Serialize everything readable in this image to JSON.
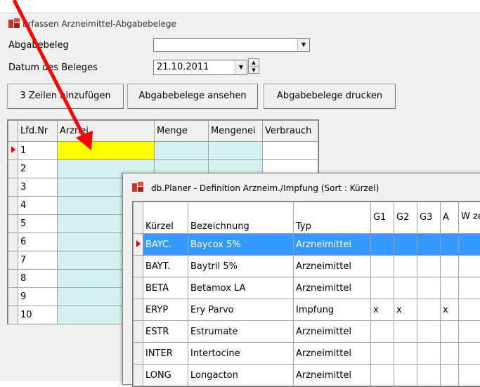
{
  "window": {
    "title": "Erfassen Arzneimittel-Abgabebelege"
  },
  "form": {
    "abgabebeleg_label": "Abgabebeleg",
    "abgabebeleg_value": "",
    "datum_label": "Datum des Beleges",
    "datum_value": "21.10.2011"
  },
  "toolbar": {
    "add_rows": "3 Zeilen hinzufügen",
    "view": "Abgabebelege ansehen",
    "print": "Abgabebelege drucken"
  },
  "main_grid": {
    "headers": [
      "Lfd.Nr",
      "Arznei",
      "Menge",
      "Mengenei",
      "Verbrauch"
    ],
    "rows": [
      "1",
      "2",
      "3",
      "4",
      "5",
      "6",
      "7",
      "8",
      "9",
      "10"
    ]
  },
  "dialog": {
    "title": "db.Planer - Definition Arzneim./Impfung (Sort : Kürzel)",
    "headers": [
      "Kürzel",
      "Bezeichnung",
      "Typ",
      "G1",
      "G2",
      "G3",
      "A",
      "W ze"
    ],
    "rows": [
      {
        "kuerzel": "BAYC.",
        "bez": "Baycox 5%",
        "typ": "Arzneimittel",
        "g1": "",
        "g2": "",
        "g3": "",
        "a": ""
      },
      {
        "kuerzel": "BAYT.",
        "bez": "Baytril 5%",
        "typ": "Arzneimittel",
        "g1": "",
        "g2": "",
        "g3": "",
        "a": ""
      },
      {
        "kuerzel": "BETA",
        "bez": "Betamox LA",
        "typ": "Arzneimittel",
        "g1": "",
        "g2": "",
        "g3": "",
        "a": ""
      },
      {
        "kuerzel": "ERYP",
        "bez": "Ery Parvo",
        "typ": "Impfung",
        "g1": "x",
        "g2": "x",
        "g3": "",
        "a": "x"
      },
      {
        "kuerzel": "ESTR",
        "bez": "Estrumate",
        "typ": "Arzneimittel",
        "g1": "",
        "g2": "",
        "g3": "",
        "a": ""
      },
      {
        "kuerzel": "INTER",
        "bez": "Intertocine",
        "typ": "Arzneimittel",
        "g1": "",
        "g2": "",
        "g3": "",
        "a": ""
      },
      {
        "kuerzel": "LONG",
        "bez": "Longacton",
        "typ": "Arzneimittel",
        "g1": "",
        "g2": "",
        "g3": "",
        "a": ""
      }
    ]
  },
  "colors": {
    "selection": "#3399ff",
    "highlight_cell": "#ffff00",
    "cyan_cells": "#d4f0f0",
    "arrow": "#ff0000"
  }
}
